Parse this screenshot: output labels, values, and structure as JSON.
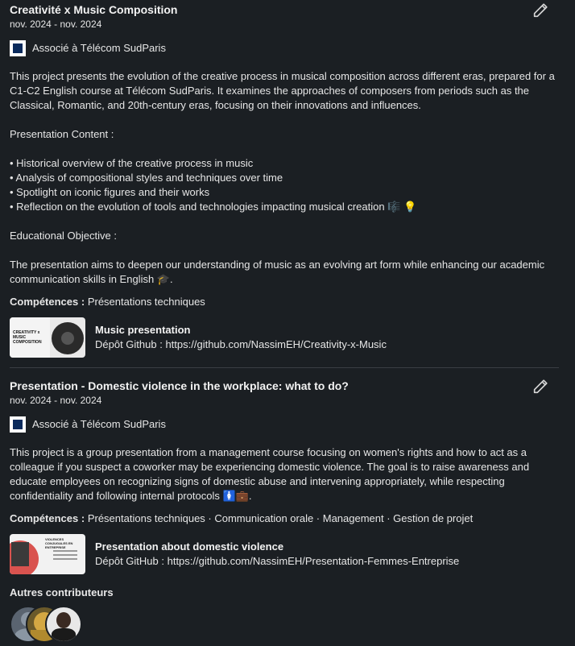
{
  "projects": [
    {
      "title": "Creativité x Music Composition",
      "dates": "nov. 2024 - nov. 2024",
      "association": "Associé à Télécom SudParis",
      "description": [
        "This project presents the evolution of the creative process in musical composition across different eras, prepared for a C1-C2 English course at Télécom SudParis. It examines the approaches of composers from periods such as the Classical, Romantic, and 20th-century eras, focusing on their innovations and influences.",
        "",
        "Presentation Content :",
        "",
        "• Historical overview of the creative process in music",
        "• Analysis of compositional styles and techniques over time",
        "• Spotlight on iconic figures and their works",
        "• Reflection on the evolution of tools and technologies impacting musical creation 🎼 💡",
        "",
        "Educational Objective :",
        "",
        "The presentation aims to deepen our understanding of music as an evolving art form while enhancing our academic communication skills in English 🎓."
      ],
      "skills_label": "Compétences :",
      "skills": "Présentations techniques",
      "media": {
        "title": "Music presentation",
        "subtitle": "Dépôt Github : https://github.com/NassimEH/Creativity-x-Music",
        "thumb_text": "CREATIVITY x MUSIC COMPOSITION"
      }
    },
    {
      "title": "Presentation - Domestic violence in the workplace: what to do?",
      "dates": "nov. 2024 - nov. 2024",
      "association": "Associé à Télécom SudParis",
      "description": [
        "This project is a group presentation from a management course focusing on women's rights and how to act as a colleague if you suspect a coworker may be experiencing domestic violence. The goal is to raise awareness and educate employees on recognizing signs of domestic abuse and intervening appropriately, while respecting confidentiality and following internal protocols 🚺💼."
      ],
      "skills_label": "Compétences :",
      "skills": "Présentations techniques · Communication orale · Management · Gestion de projet",
      "media": {
        "title": "Presentation about domestic violence",
        "subtitle": "Dépôt GitHub : https://github.com/NassimEH/Presentation-Femmes-Entreprise",
        "thumb_text": "VIOLENCES CONJUGALES EN ENTREPRISE"
      }
    }
  ],
  "contributors_title": "Autres contributeurs",
  "icons": {
    "edit": "pencil-icon",
    "logo": "telecom-sudparis-logo"
  },
  "colors": {
    "background": "#1b1f23",
    "text": "#e8e8e8",
    "divider": "#3a3f44"
  }
}
